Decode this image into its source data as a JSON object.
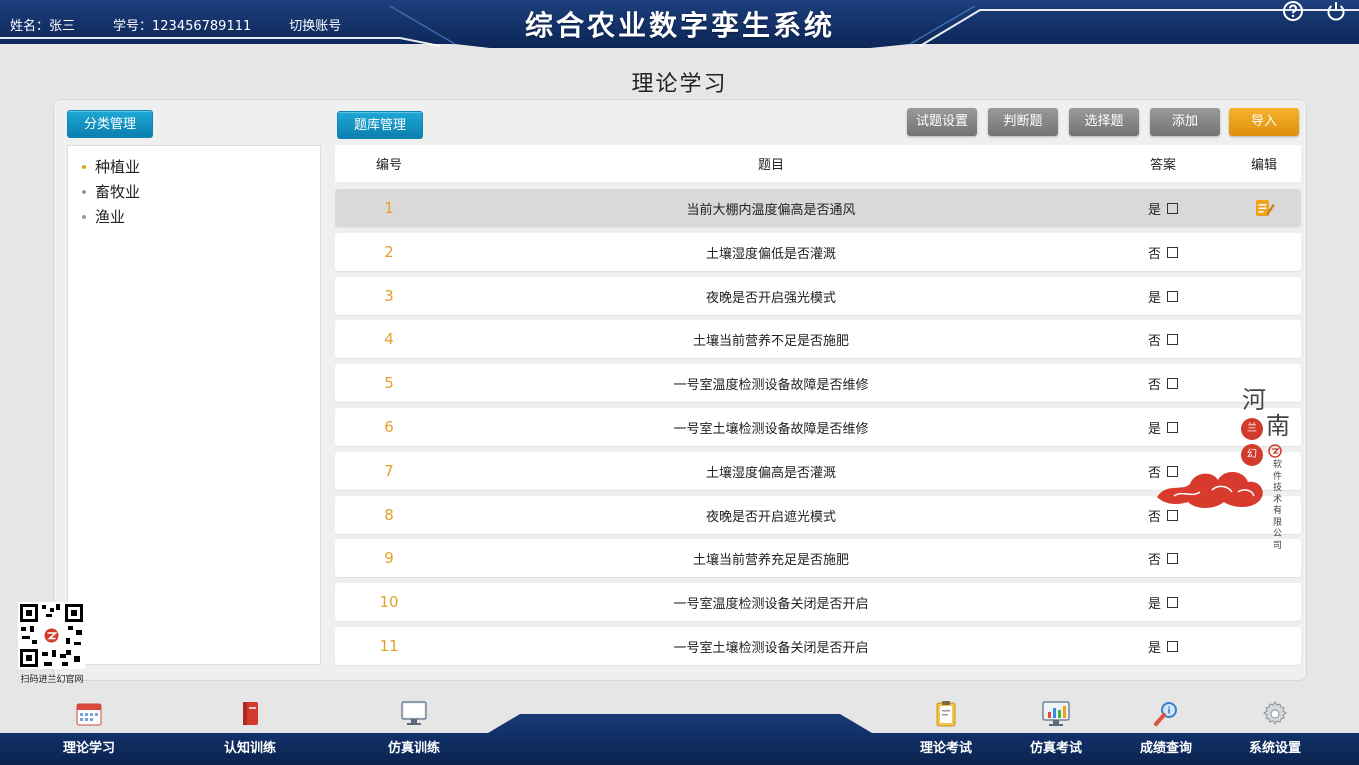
{
  "header": {
    "name_label": "姓名：张三",
    "student_id_label": "学号：123456789111",
    "switch_account": "切换账号",
    "app_title": "综合农业数字孪生系统",
    "icons": [
      "help-icon",
      "power-icon"
    ]
  },
  "page_title": "理论学习",
  "sidebar": {
    "header_button": "分类管理",
    "items": [
      {
        "label": "种植业",
        "active": true
      },
      {
        "label": "畜牧业",
        "active": false
      },
      {
        "label": "渔业",
        "active": false
      }
    ]
  },
  "toolbar": {
    "bank_button": "题库管理",
    "buttons": [
      "试题设置",
      "判断题",
      "选择题",
      "添加",
      "导入"
    ]
  },
  "table": {
    "columns": [
      "编号",
      "题目",
      "答案",
      "编辑"
    ],
    "rows": [
      {
        "num": "1",
        "question": "当前大棚内温度偏高是否通风",
        "answer": "是"
      },
      {
        "num": "2",
        "question": "土壤湿度偏低是否灌溉",
        "answer": "否"
      },
      {
        "num": "3",
        "question": "夜晚是否开启强光模式",
        "answer": "是"
      },
      {
        "num": "4",
        "question": "土壤当前营养不足是否施肥",
        "answer": "否"
      },
      {
        "num": "5",
        "question": "一号室温度检测设备故障是否维修",
        "answer": "否"
      },
      {
        "num": "6",
        "question": "一号室土壤检测设备故障是否维修",
        "answer": "是"
      },
      {
        "num": "7",
        "question": "土壤湿度偏高是否灌溉",
        "answer": "否"
      },
      {
        "num": "8",
        "question": "夜晚是否开启遮光模式",
        "answer": "否"
      },
      {
        "num": "9",
        "question": "土壤当前营养充足是否施肥",
        "answer": "否"
      },
      {
        "num": "10",
        "question": "一号室温度检测设备关闭是否开启",
        "answer": "是"
      },
      {
        "num": "11",
        "question": "一号室土壤检测设备关闭是否开启",
        "answer": "是"
      }
    ]
  },
  "watermark": {
    "line1": "河",
    "line2": "南",
    "seal1": "兰",
    "seal2": "幻",
    "company": "软件技术有限公司"
  },
  "qr_label": "扫码进兰幻官网",
  "bottom_nav": [
    {
      "label": "理论学习",
      "icon": "calendar-icon"
    },
    {
      "label": "认知训练",
      "icon": "book-icon"
    },
    {
      "label": "仿真训练",
      "icon": "monitor-icon"
    },
    {
      "label": "理论考试",
      "icon": "clipboard-icon"
    },
    {
      "label": "仿真考试",
      "icon": "chart-screen-icon"
    },
    {
      "label": "成绩查询",
      "icon": "magnifier-icon"
    },
    {
      "label": "系统设置",
      "icon": "gear-icon"
    }
  ],
  "colors": {
    "header_blue": "#0f2f66",
    "accent_teal": "#0a8fc2",
    "number_orange": "#e3a12a",
    "import_orange": "#f0a21e"
  }
}
